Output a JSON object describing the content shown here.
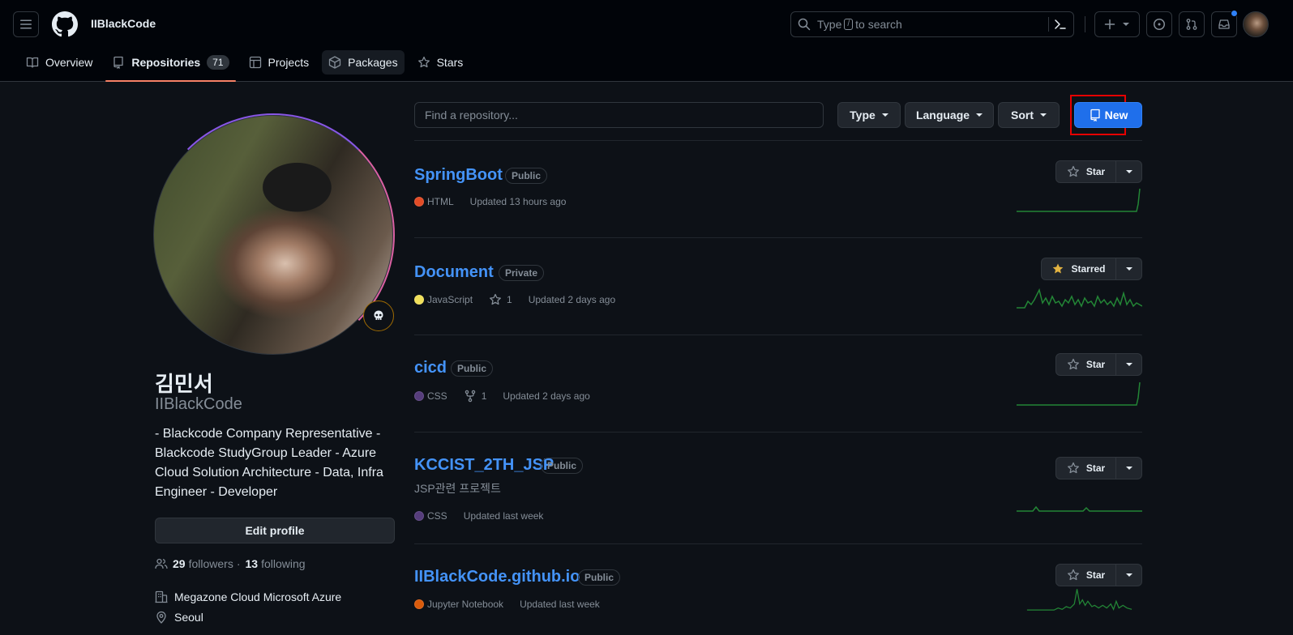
{
  "header": {
    "user_login": "IIBlackCode",
    "search_prefix": "Type",
    "search_key": "/",
    "search_suffix": "to search"
  },
  "tabs": [
    {
      "label": "Overview"
    },
    {
      "label": "Repositories",
      "count": "71"
    },
    {
      "label": "Projects"
    },
    {
      "label": "Packages"
    },
    {
      "label": "Stars"
    }
  ],
  "profile": {
    "name": "김민서",
    "login": "IIBlackCode",
    "bio": "- Blackcode Company Representative - Blackcode StudyGroup Leader - Azure Cloud Solution Architecture - Data, Infra Engineer - Developer",
    "edit_label": "Edit profile",
    "followers_count": "29",
    "followers_label": "followers",
    "separator": "·",
    "following_count": "13",
    "following_label": "following",
    "company": "Megazone Cloud Microsoft Azure",
    "location": "Seoul",
    "status_icon": "skull-icon"
  },
  "filters": {
    "search_placeholder": "Find a repository...",
    "type_label": "Type",
    "language_label": "Language",
    "sort_label": "Sort",
    "new_label": "New"
  },
  "colors": {
    "accent": "#1f6feb",
    "link": "#4493f8",
    "highlight_box": "#e60000",
    "selected_tab_underline": "#f78166",
    "sparkline": "#238636"
  },
  "repos": [
    {
      "name": "SpringBoot",
      "visibility": "Public",
      "language": "HTML",
      "language_color": "#e34c26",
      "updated": "Updated 13 hours ago",
      "star_label": "Star",
      "starred": false
    },
    {
      "name": "Document",
      "visibility": "Private",
      "language": "JavaScript",
      "language_color": "#f1e05a",
      "stars": "1",
      "updated": "Updated 2 days ago",
      "star_label": "Starred",
      "starred": true
    },
    {
      "name": "cicd",
      "visibility": "Public",
      "language": "CSS",
      "language_color": "#563d7c",
      "forks": "1",
      "updated": "Updated 2 days ago",
      "star_label": "Star",
      "starred": false
    },
    {
      "name": "KCCIST_2TH_JSP",
      "visibility": "Public",
      "description": "JSP관련 프로젝트",
      "language": "CSS",
      "language_color": "#563d7c",
      "updated": "Updated last week",
      "star_label": "Star",
      "starred": false
    },
    {
      "name": "IIBlackCode.github.io",
      "visibility": "Public",
      "language": "Jupyter Notebook",
      "language_color": "#DA5B0B",
      "updated": "Updated last week",
      "star_label": "Star",
      "starred": false
    }
  ]
}
